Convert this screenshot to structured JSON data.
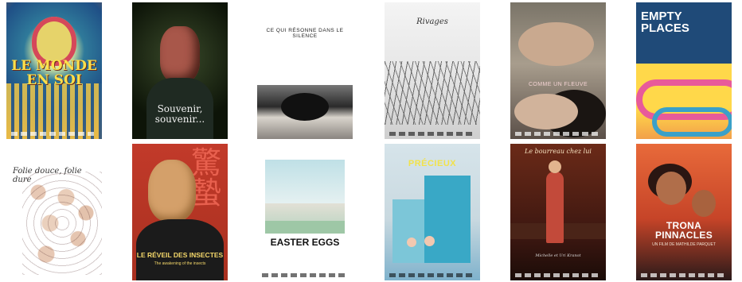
{
  "posters": [
    {
      "id": "p1",
      "title": "LE MONDE EN SOI"
    },
    {
      "id": "p2",
      "title": "Souvenir, souvenir..."
    },
    {
      "id": "p3",
      "title": "CE QUI RÉSONNE DANS LE SILENCE"
    },
    {
      "id": "p4",
      "title": "Rivages"
    },
    {
      "id": "p5",
      "title": "COMME UN FLEUVE"
    },
    {
      "id": "p6",
      "title": "EMPTY PLACES"
    },
    {
      "id": "p7",
      "title": "Folie douce, folie dure"
    },
    {
      "id": "p8",
      "title": "LE RÉVEIL DES INSECTES",
      "subtitle": "The awakening of the insects",
      "kanji": "驚蟄"
    },
    {
      "id": "p9",
      "title": "EASTER EGGS"
    },
    {
      "id": "p10",
      "title": "PRÉCIEUX"
    },
    {
      "id": "p11",
      "title": "Le bourreau chez lui",
      "credits": "Michelle et Uri Kranot"
    },
    {
      "id": "p12",
      "title": "TRONA PINNACLES",
      "subtitle": "UN FILM DE MATHILDE PARQUET"
    }
  ]
}
